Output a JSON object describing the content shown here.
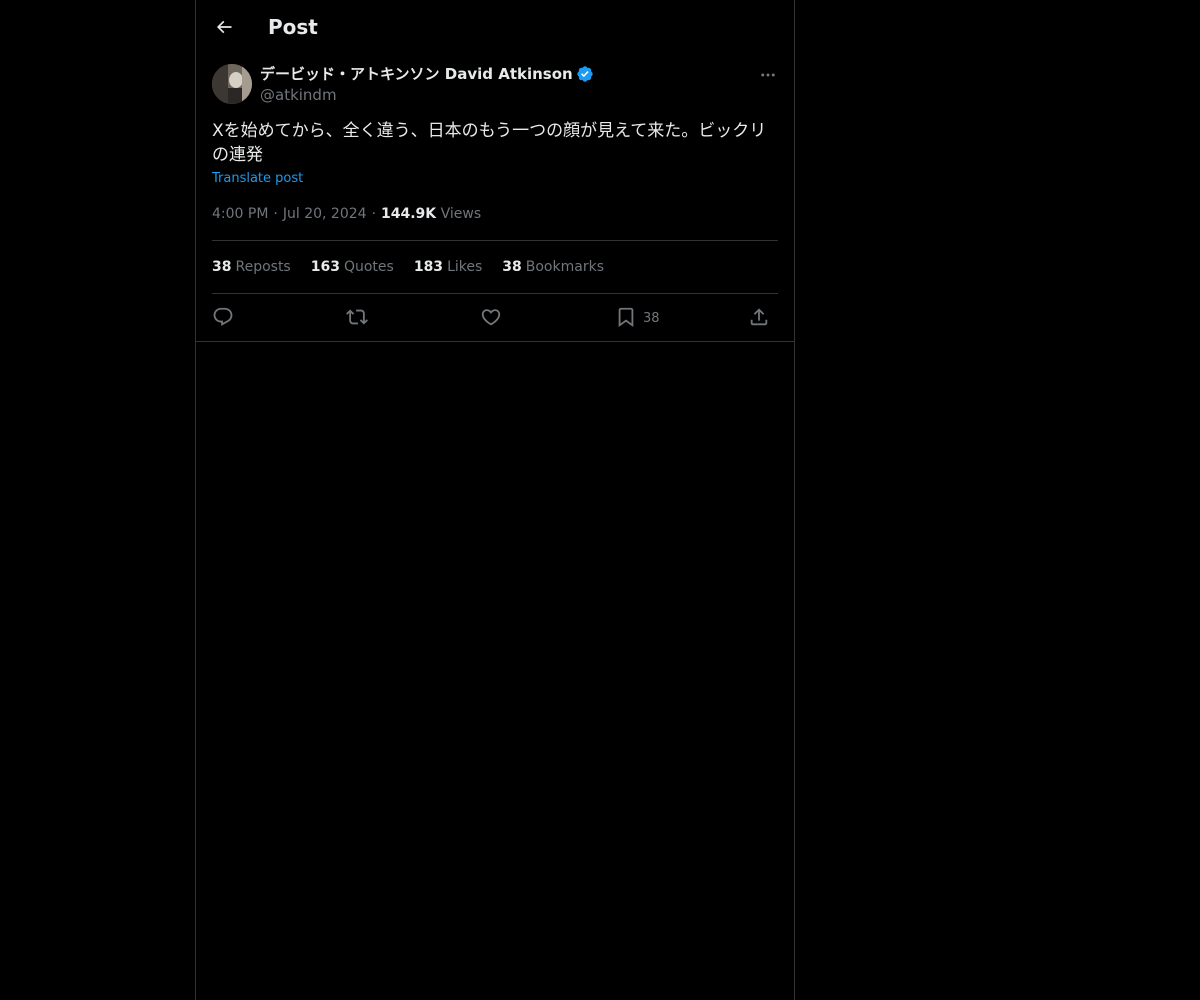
{
  "header": {
    "title": "Post"
  },
  "post": {
    "author_name": "デービッド・アトキンソン David Atkinson",
    "handle": "@atkindm",
    "text": "Xを始めてから、全く違う、日本のもう一つの顔が見えて来た。ビックリの連発",
    "translate_label": "Translate post",
    "time": "4:00 PM",
    "date": "Jul 20, 2024",
    "views_count": "144.9K",
    "views_label": "Views",
    "separator": "·"
  },
  "stats": [
    {
      "count": "38",
      "label": "Reposts"
    },
    {
      "count": "163",
      "label": "Quotes"
    },
    {
      "count": "183",
      "label": "Likes"
    },
    {
      "count": "38",
      "label": "Bookmarks"
    }
  ],
  "actions": {
    "reply_icon": "reply-icon",
    "repost_icon": "repost-icon",
    "like_icon": "heart-icon",
    "bookmark_icon": "bookmark-icon",
    "bookmark_count": "38",
    "share_icon": "share-icon"
  },
  "colors": {
    "background": "#000000",
    "text_primary": "#e7e9ea",
    "text_secondary": "#71767b",
    "accent": "#1d9bf0",
    "border": "#2f3336"
  }
}
